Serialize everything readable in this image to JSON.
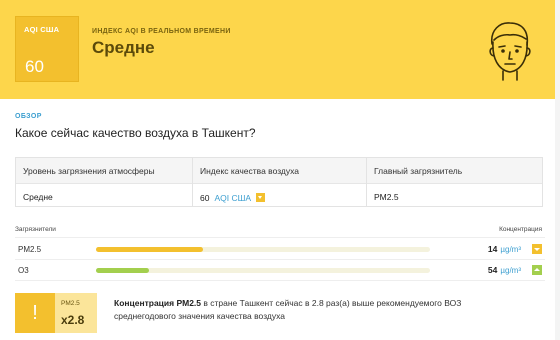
{
  "colors": {
    "banner": "#FDD64B",
    "aqi_box": "#F3C02E",
    "accent_blue": "#3d9fd0",
    "pm25_bar": "#F3C02E",
    "o3_bar": "#A3CF4E"
  },
  "header": {
    "aqi_label": "AQI США",
    "aqi_value": "60",
    "realtime_label": "ИНДЕКС AQI В РЕАЛЬНОМ ВРЕМЕНИ",
    "level": "Средне",
    "face_icon": "neutral-face-icon"
  },
  "overview": {
    "tag": "ОБЗОР",
    "question": "Какое сейчас качество воздуха в Ташкент?"
  },
  "table": {
    "headers": [
      "Уровень загрязнения атмосферы",
      "Индекс качества воздуха",
      "Главный загрязнитель"
    ],
    "level": "Средне",
    "aqi_value": "60",
    "aqi_unit": "AQI США",
    "main_pollutant": "PM2.5"
  },
  "pollutants": {
    "header_left": "Загрязнители",
    "header_right": "Концентрация",
    "items": [
      {
        "name": "PM2.5",
        "value": "14",
        "unit": "µg/m³",
        "level": 0.32,
        "trend": "down"
      },
      {
        "name": "O3",
        "value": "54",
        "unit": "µg/m³",
        "level": 0.16,
        "trend": "up"
      }
    ]
  },
  "callout": {
    "icon_text": "!",
    "key": "PM2.5",
    "multiplier": "x2.8",
    "bold_text": "Концентрация PM2.5",
    "text": " в стране Ташкент сейчас в 2.8 раз(а) выше рекомендуемого ВОЗ среднегодового значения качества воздуха"
  }
}
